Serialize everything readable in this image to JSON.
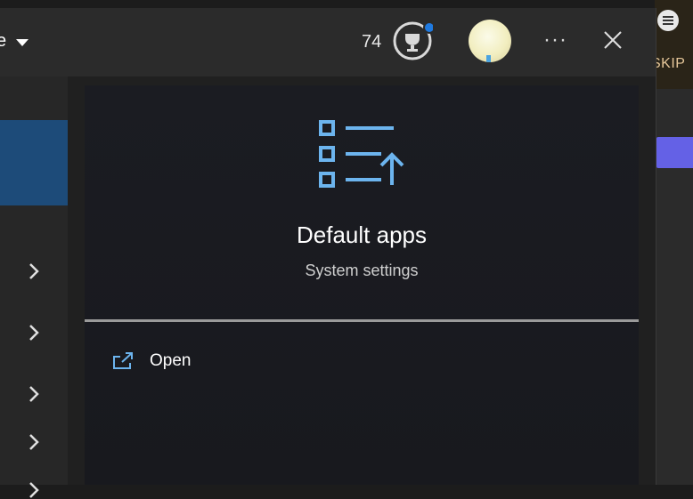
{
  "header": {
    "dropdown_text": "e",
    "score": "74"
  },
  "app": {
    "title": "Default apps",
    "subtitle": "System settings"
  },
  "actions": {
    "open_label": "Open"
  },
  "background_app": {
    "skip_label": "SKIP"
  },
  "colors": {
    "accent": "#6cb4ee",
    "selected_nav": "#1d4b79",
    "notification_dot": "#1f7ae0",
    "purple_button": "#6461e6"
  },
  "icons": {
    "trophy": "trophy-icon",
    "close": "close-icon",
    "more": "more-options-icon",
    "open": "open-external-icon",
    "app": "default-apps-icon"
  }
}
